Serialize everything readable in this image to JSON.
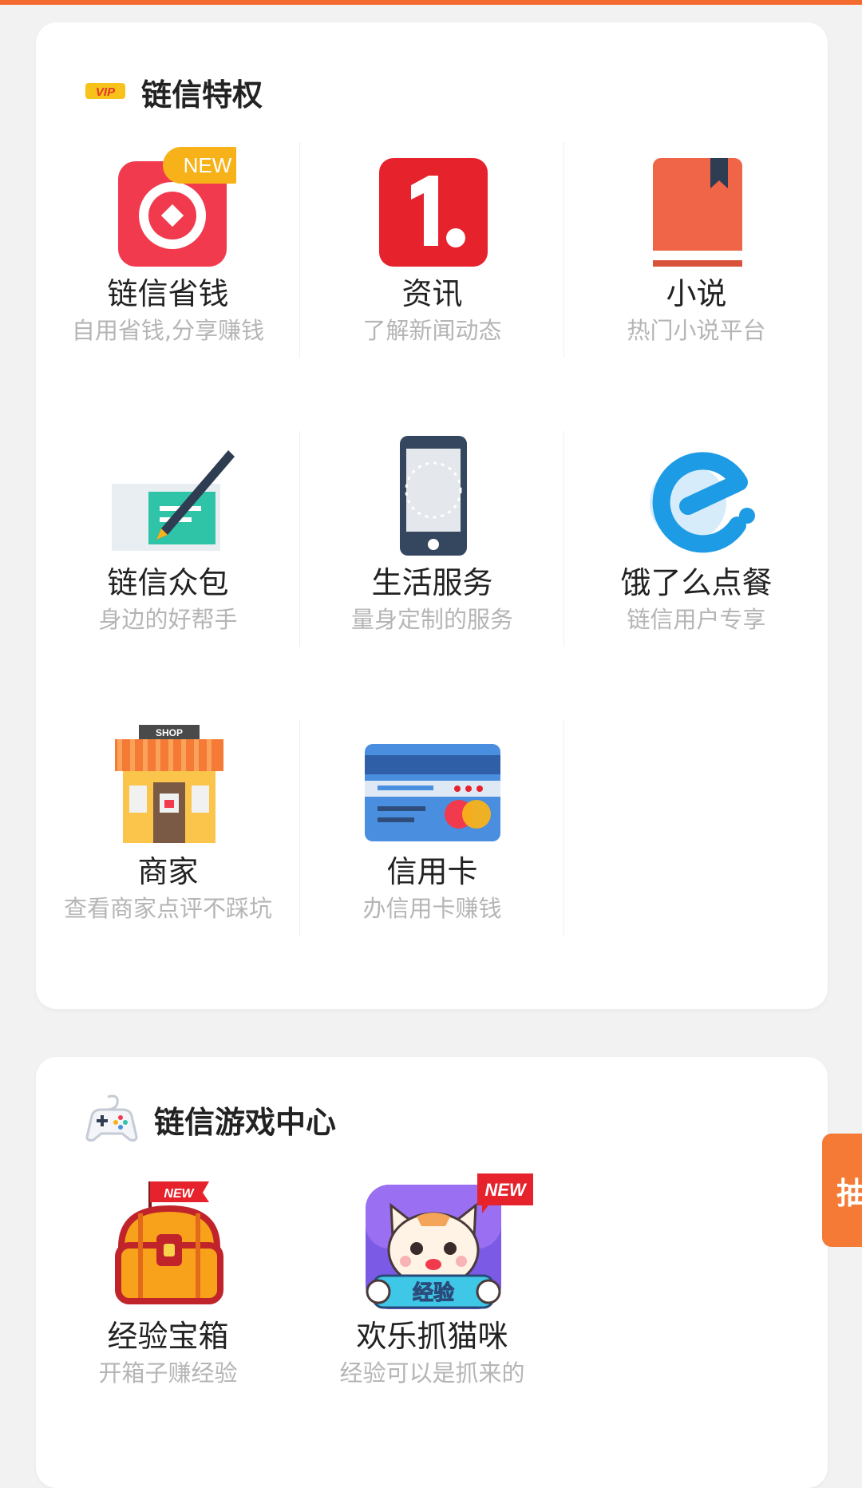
{
  "privileges": {
    "title": "链信特权",
    "badge_text": "VIP",
    "items": [
      {
        "label": "链信省钱",
        "sub": "自用省钱,分享赚钱",
        "icon": "wallet-icon",
        "badge": "NEW"
      },
      {
        "label": "资讯",
        "sub": "了解新闻动态",
        "icon": "news-icon"
      },
      {
        "label": "小说",
        "sub": "热门小说平台",
        "icon": "book-icon"
      },
      {
        "label": "链信众包",
        "sub": "身边的好帮手",
        "icon": "pen-task-icon"
      },
      {
        "label": "生活服务",
        "sub": "量身定制的服务",
        "icon": "phone-icon"
      },
      {
        "label": "饿了么点餐",
        "sub": "链信用户专享",
        "icon": "eleme-icon"
      },
      {
        "label": "商家",
        "sub": "查看商家点评不踩坑",
        "icon": "shop-icon",
        "shop_sign": "SHOP"
      },
      {
        "label": "信用卡",
        "sub": "办信用卡赚钱",
        "icon": "credit-card-icon"
      }
    ]
  },
  "games": {
    "title": "链信游戏中心",
    "items": [
      {
        "label": "经验宝箱",
        "sub": "开箱子赚经验",
        "icon": "treasure-chest-icon",
        "badge": "NEW"
      },
      {
        "label": "欢乐抓猫咪",
        "sub": "经验可以是抓来的",
        "icon": "cat-game-icon",
        "badge": "NEW",
        "banner": "经验"
      }
    ]
  },
  "side_tab": {
    "label": "抽"
  },
  "colors": {
    "accent": "#f46a2f",
    "vip": "#f7c21a"
  }
}
